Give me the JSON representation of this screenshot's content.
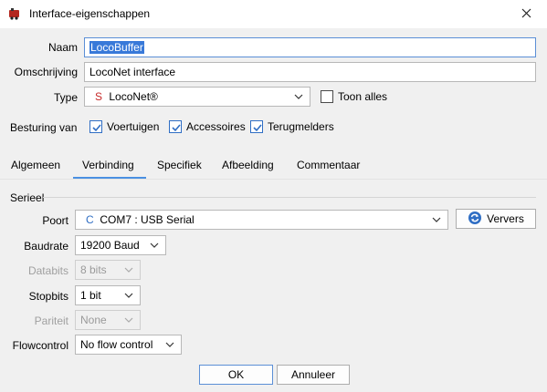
{
  "window": {
    "title": "Interface-eigenschappen"
  },
  "form": {
    "name_label": "Naam",
    "name_value": "LocoBuffer",
    "description_label": "Omschrijving",
    "description_value": "LocoNet interface",
    "type_label": "Type",
    "type_prefix": "S",
    "type_value": "LocoNet®",
    "show_all_label": "Toon alles",
    "control_label": "Besturing van",
    "control_options": [
      {
        "label": "Voertuigen",
        "checked": true
      },
      {
        "label": "Accessoires",
        "checked": true
      },
      {
        "label": "Terugmelders",
        "checked": true
      }
    ]
  },
  "tabs": [
    {
      "label": "Algemeen"
    },
    {
      "label": "Verbinding",
      "active": true
    },
    {
      "label": "Specifiek"
    },
    {
      "label": "Afbeelding"
    },
    {
      "label": "Commentaar"
    }
  ],
  "serial": {
    "section_label": "Serieel",
    "port_label": "Poort",
    "port_prefix": "C",
    "port_value": "COM7 : USB Serial",
    "refresh_label": "Ververs",
    "baud_label": "Baudrate",
    "baud_value": "19200 Baud",
    "databits_label": "Databits",
    "databits_value": "8 bits",
    "stopbits_label": "Stopbits",
    "stopbits_value": "1 bit",
    "parity_label": "Pariteit",
    "parity_value": "None",
    "flow_label": "Flowcontrol",
    "flow_value": "No flow control"
  },
  "buttons": {
    "ok": "OK",
    "cancel": "Annuleer"
  },
  "colors": {
    "accent": "#4a90e2",
    "selection": "#3879d9",
    "type_icon": "#c62828",
    "port_icon": "#2f6ec4"
  }
}
